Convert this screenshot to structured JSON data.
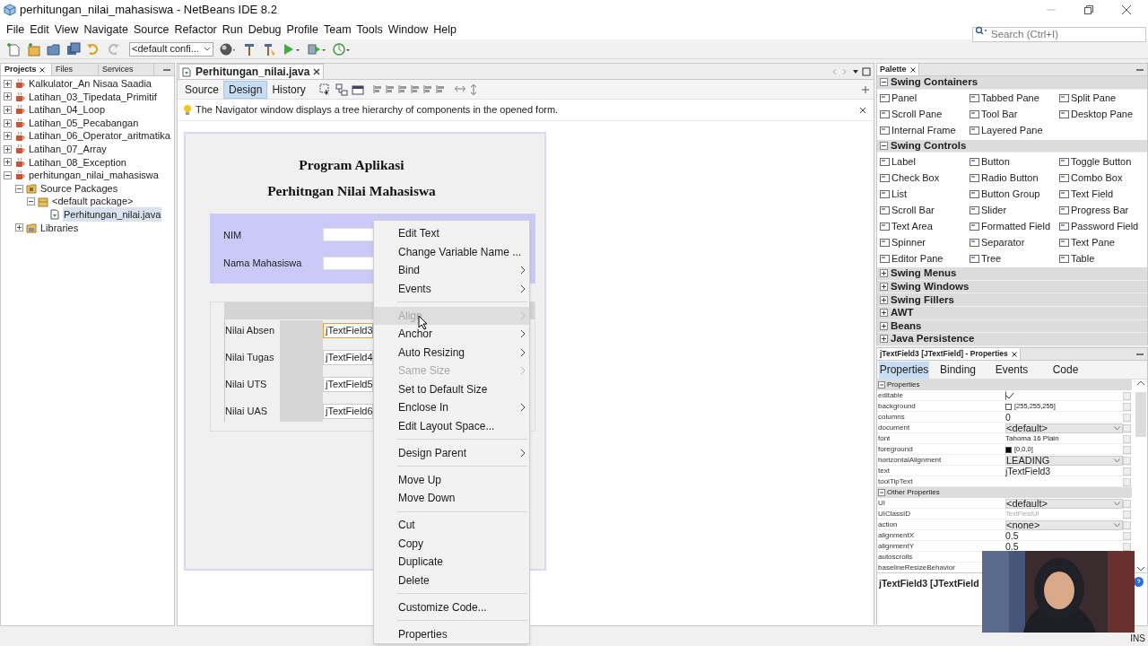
{
  "window": {
    "title": "perhitungan_nilai_mahasiswa - NetBeans IDE 8.2"
  },
  "menu": [
    "File",
    "Edit",
    "View",
    "Navigate",
    "Source",
    "Refactor",
    "Run",
    "Debug",
    "Profile",
    "Team",
    "Tools",
    "Window",
    "Help"
  ],
  "search": {
    "placeholder": "Search (Ctrl+I)"
  },
  "toolbar": {
    "config": "<default confi..."
  },
  "left_panel": {
    "tabs": [
      {
        "label": "Projects",
        "selected": true
      },
      {
        "label": "Files",
        "selected": false
      },
      {
        "label": "Services",
        "selected": false
      }
    ],
    "tree": [
      {
        "label": "Kalkulator_An Nisaa Saadia",
        "kind": "project",
        "expanded": false,
        "selected": false
      },
      {
        "label": "Latihan_03_Tipedata_Primitif",
        "kind": "project",
        "expanded": false,
        "selected": false
      },
      {
        "label": "Latihan_04_Loop",
        "kind": "project",
        "expanded": false,
        "selected": false
      },
      {
        "label": "Latihan_05_Pecabangan",
        "kind": "project",
        "expanded": false,
        "selected": false
      },
      {
        "label": "Latihan_06_Operator_aritmatika",
        "kind": "project",
        "expanded": false,
        "selected": false
      },
      {
        "label": "Latihan_07_Array",
        "kind": "project",
        "expanded": false,
        "selected": false
      },
      {
        "label": "Latihan_08_Exception",
        "kind": "project",
        "expanded": false,
        "selected": false
      },
      {
        "label": "perhitungan_nilai_mahasiswa",
        "kind": "project",
        "expanded": true,
        "selected": false,
        "children": [
          {
            "label": "Source Packages",
            "kind": "folder",
            "expanded": true,
            "selected": false,
            "children": [
              {
                "label": "<default package>",
                "kind": "package",
                "expanded": true,
                "selected": false,
                "children": [
                  {
                    "label": "Perhitungan_nilai.java",
                    "kind": "file",
                    "selected": true
                  }
                ]
              }
            ]
          },
          {
            "label": "Libraries",
            "kind": "library",
            "expanded": false,
            "selected": false
          }
        ]
      }
    ]
  },
  "editor": {
    "tab": "Perhitungan_nilai.java",
    "views": [
      {
        "label": "Source",
        "selected": false
      },
      {
        "label": "Design",
        "selected": true
      },
      {
        "label": "History",
        "selected": false
      }
    ],
    "info": "The Navigator window displays a tree hierarchy of components in the opened form."
  },
  "form": {
    "title_lines": [
      "Program Aplikasi",
      "Perhitngan Nilai Mahasiswa"
    ],
    "top_fields": [
      {
        "label": "NIM"
      },
      {
        "label": "Nama Mahasiswa"
      }
    ],
    "score_fields": [
      {
        "label": "Nilai Absen",
        "value": "jTextField3",
        "selected": true
      },
      {
        "label": "Nilai Tugas",
        "value": "jTextField4",
        "selected": false
      },
      {
        "label": "Nilai UTS",
        "value": "jTextField5",
        "selected": false
      },
      {
        "label": "Nilai UAS",
        "value": "jTextField6",
        "selected": false
      }
    ]
  },
  "context_menu": [
    {
      "kind": "item",
      "label": "Edit Text",
      "submenu": false,
      "disabled": false,
      "highlighted": false
    },
    {
      "kind": "item",
      "label": "Change Variable Name ...",
      "submenu": false,
      "disabled": false,
      "highlighted": false
    },
    {
      "kind": "item",
      "label": "Bind",
      "submenu": true,
      "disabled": false,
      "highlighted": false
    },
    {
      "kind": "item",
      "label": "Events",
      "submenu": true,
      "disabled": false,
      "highlighted": false
    },
    {
      "kind": "separator"
    },
    {
      "kind": "item",
      "label": "Align",
      "submenu": true,
      "disabled": true,
      "highlighted": true
    },
    {
      "kind": "item",
      "label": "Anchor",
      "submenu": true,
      "disabled": false,
      "highlighted": false
    },
    {
      "kind": "item",
      "label": "Auto Resizing",
      "submenu": true,
      "disabled": false,
      "highlighted": false
    },
    {
      "kind": "item",
      "label": "Same Size",
      "submenu": true,
      "disabled": true,
      "highlighted": false
    },
    {
      "kind": "item",
      "label": "Set to Default Size",
      "submenu": false,
      "disabled": false,
      "highlighted": false
    },
    {
      "kind": "item",
      "label": "Enclose In",
      "submenu": true,
      "disabled": false,
      "highlighted": false
    },
    {
      "kind": "item",
      "label": "Edit Layout Space...",
      "submenu": false,
      "disabled": false,
      "highlighted": false
    },
    {
      "kind": "separator"
    },
    {
      "kind": "item",
      "label": "Design Parent",
      "submenu": true,
      "disabled": false,
      "highlighted": false
    },
    {
      "kind": "separator"
    },
    {
      "kind": "item",
      "label": "Move Up",
      "submenu": false,
      "disabled": false,
      "highlighted": false
    },
    {
      "kind": "item",
      "label": "Move Down",
      "submenu": false,
      "disabled": false,
      "highlighted": false
    },
    {
      "kind": "separator"
    },
    {
      "kind": "item",
      "label": "Cut",
      "submenu": false,
      "disabled": false,
      "highlighted": false
    },
    {
      "kind": "item",
      "label": "Copy",
      "submenu": false,
      "disabled": false,
      "highlighted": false
    },
    {
      "kind": "item",
      "label": "Duplicate",
      "submenu": false,
      "disabled": false,
      "highlighted": false
    },
    {
      "kind": "item",
      "label": "Delete",
      "submenu": false,
      "disabled": false,
      "highlighted": false
    },
    {
      "kind": "separator"
    },
    {
      "kind": "item",
      "label": "Customize Code...",
      "submenu": false,
      "disabled": false,
      "highlighted": false
    },
    {
      "kind": "separator"
    },
    {
      "kind": "item",
      "label": "Properties",
      "submenu": false,
      "disabled": false,
      "highlighted": false
    }
  ],
  "palette": {
    "title": "Palette",
    "sections": [
      {
        "title": "Swing Containers",
        "expanded": true,
        "items": [
          "Panel",
          "Tabbed Pane",
          "Split Pane",
          "Scroll Pane",
          "Tool Bar",
          "Desktop Pane",
          "Internal Frame",
          "Layered Pane"
        ]
      },
      {
        "title": "Swing Controls",
        "expanded": true,
        "items": [
          "Label",
          "Button",
          "Toggle Button",
          "Check Box",
          "Radio Button",
          "Combo Box",
          "List",
          "Button Group",
          "Text Field",
          "Scroll Bar",
          "Slider",
          "Progress Bar",
          "Text Area",
          "Formatted Field",
          "Password Field",
          "Spinner",
          "Separator",
          "Text Pane",
          "Editor Pane",
          "Tree",
          "Table"
        ]
      },
      {
        "title": "Swing Menus",
        "expanded": false
      },
      {
        "title": "Swing Windows",
        "expanded": false
      },
      {
        "title": "Swing Fillers",
        "expanded": false
      },
      {
        "title": "AWT",
        "expanded": false
      },
      {
        "title": "Beans",
        "expanded": false
      },
      {
        "title": "Java Persistence",
        "expanded": false
      }
    ]
  },
  "properties": {
    "title": "jTextField3 [JTextField] - Properties",
    "tabs": [
      {
        "label": "Properties",
        "selected": true
      },
      {
        "label": "Binding",
        "selected": false
      },
      {
        "label": "Events",
        "selected": false
      },
      {
        "label": "Code",
        "selected": false
      }
    ],
    "groups": [
      {
        "title": "Properties",
        "expanded": true,
        "rows": [
          {
            "name": "editable",
            "kind": "check",
            "checked": true
          },
          {
            "name": "background",
            "kind": "color",
            "color": "#ffffff",
            "value": "[255,255,255]"
          },
          {
            "name": "columns",
            "kind": "value",
            "value": "0"
          },
          {
            "name": "document",
            "kind": "combo",
            "value": "<default>"
          },
          {
            "name": "font",
            "kind": "plain",
            "value": "Tahoma 16 Plain"
          },
          {
            "name": "foreground",
            "kind": "color",
            "color": "#000000",
            "value": "[0,0,0]"
          },
          {
            "name": "horizontalAlignment",
            "kind": "combo",
            "value": "LEADING"
          },
          {
            "name": "text",
            "kind": "value",
            "value": "jTextField3"
          },
          {
            "name": "toolTipText",
            "kind": "empty"
          }
        ]
      },
      {
        "title": "Other Properties",
        "expanded": true,
        "rows": [
          {
            "name": "UI",
            "kind": "combo",
            "value": "<default>"
          },
          {
            "name": "UIClassID",
            "kind": "readonly",
            "value": "TextFieldUI"
          },
          {
            "name": "action",
            "kind": "combo",
            "value": "<none>"
          },
          {
            "name": "alignmentX",
            "kind": "value",
            "value": "0.5"
          },
          {
            "name": "alignmentY",
            "kind": "value",
            "value": "0.5"
          },
          {
            "name": "autoscrolls",
            "kind": "covered"
          },
          {
            "name": "baselineResizeBehavior",
            "kind": "covered"
          }
        ]
      }
    ],
    "description": "jTextField3 [JTextField"
  },
  "status": {
    "mode": "INS"
  }
}
